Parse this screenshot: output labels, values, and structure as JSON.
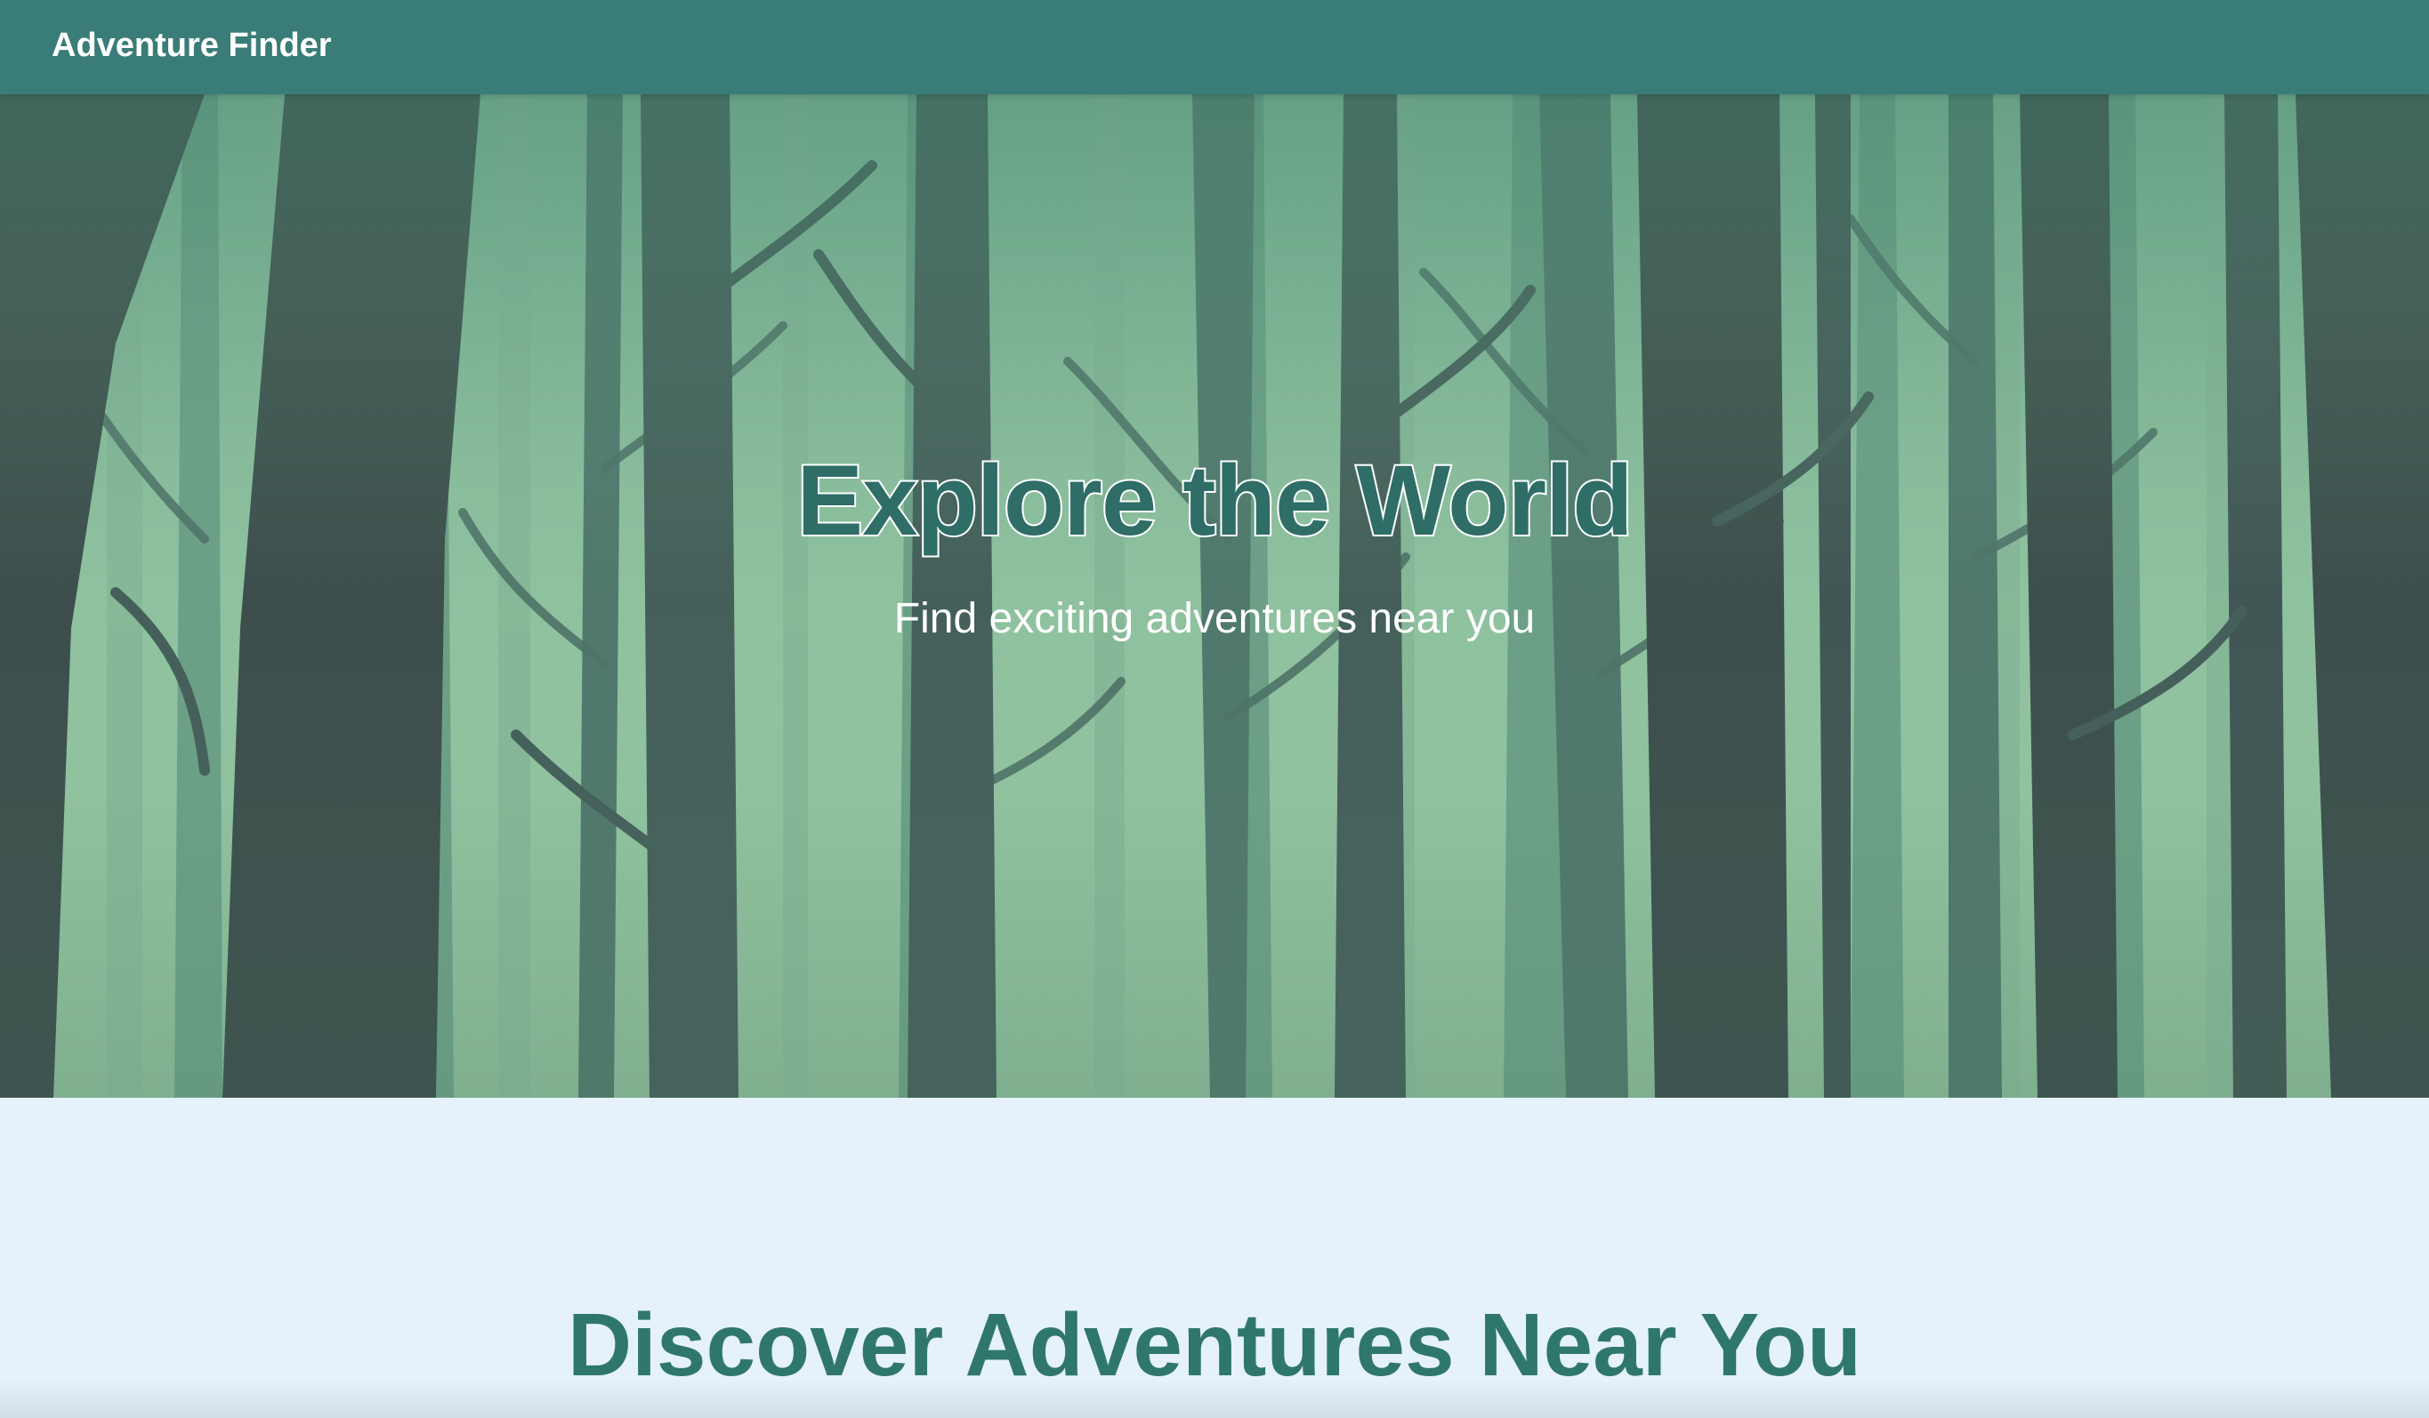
{
  "navbar": {
    "brand": "Adventure Finder"
  },
  "hero": {
    "title": "Explore the World",
    "subtitle": "Find exciting adventures near you",
    "background_image": "forest-illustration"
  },
  "discover": {
    "title": "Discover Adventures Near You"
  },
  "colors": {
    "navbar": "#3a7d78",
    "accent": "#2f776d",
    "page_background": "#e6f2fb",
    "hero_text": "#ffffff"
  }
}
